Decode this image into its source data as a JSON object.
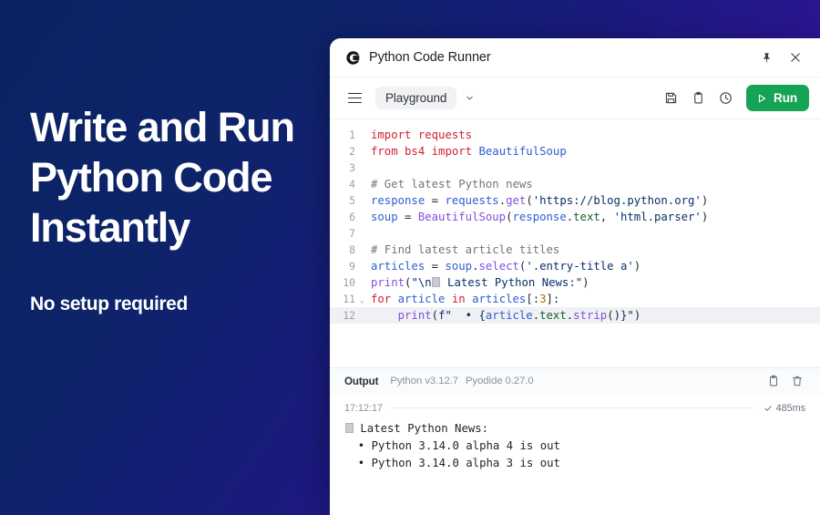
{
  "promo": {
    "title_lines": [
      "Write and Run",
      "Python Code",
      "Instantly"
    ],
    "subtitle": "No setup required",
    "colors": {
      "gradient_start": "#0a2364",
      "gradient_end": "#4512a6",
      "text": "#ffffff"
    }
  },
  "window": {
    "title": "Python Code Runner",
    "logo_icon": "brand-c-logo-icon",
    "pin_icon": "pushpin-icon",
    "close_icon": "close-icon"
  },
  "toolbar": {
    "menu_icon": "hamburger-menu-icon",
    "project_name": "Playground",
    "chevron_icon": "chevron-down-icon",
    "save_icon": "save-disk-icon",
    "copy_icon": "clipboard-icon",
    "history_icon": "clock-history-icon",
    "run_label": "Run",
    "run_icon": "play-triangle-icon",
    "run_color": "#15a355"
  },
  "editor": {
    "active_line": 12,
    "fold_marker_line": 11,
    "lines": [
      {
        "n": "1",
        "fold": "",
        "tokens": [
          {
            "t": "import",
            "c": "t-kw"
          },
          {
            "t": " requests",
            "c": "t-kw"
          }
        ]
      },
      {
        "n": "2",
        "fold": "",
        "tokens": [
          {
            "t": "from",
            "c": "t-kw"
          },
          {
            "t": " ",
            "c": "t-pun"
          },
          {
            "t": "bs4",
            "c": "t-kw"
          },
          {
            "t": " ",
            "c": "t-pun"
          },
          {
            "t": "import",
            "c": "t-kw"
          },
          {
            "t": " ",
            "c": "t-pun"
          },
          {
            "t": "BeautifulSoup",
            "c": "t-var"
          }
        ]
      },
      {
        "n": "3",
        "fold": "",
        "tokens": []
      },
      {
        "n": "4",
        "fold": "",
        "tokens": [
          {
            "t": "# Get latest Python news",
            "c": "t-com"
          }
        ]
      },
      {
        "n": "5",
        "fold": "",
        "tokens": [
          {
            "t": "response",
            "c": "t-var"
          },
          {
            "t": " = ",
            "c": "t-pun"
          },
          {
            "t": "requests",
            "c": "t-var"
          },
          {
            "t": ".",
            "c": "t-pun"
          },
          {
            "t": "get",
            "c": "t-fn"
          },
          {
            "t": "(",
            "c": "t-pun"
          },
          {
            "t": "'https://blog.python.org'",
            "c": "t-str"
          },
          {
            "t": ")",
            "c": "t-pun"
          }
        ]
      },
      {
        "n": "6",
        "fold": "",
        "tokens": [
          {
            "t": "soup",
            "c": "t-var"
          },
          {
            "t": " = ",
            "c": "t-pun"
          },
          {
            "t": "BeautifulSoup",
            "c": "t-cls"
          },
          {
            "t": "(",
            "c": "t-pun"
          },
          {
            "t": "response",
            "c": "t-var"
          },
          {
            "t": ".",
            "c": "t-pun"
          },
          {
            "t": "text",
            "c": "t-attr"
          },
          {
            "t": ", ",
            "c": "t-pun"
          },
          {
            "t": "'html.parser'",
            "c": "t-str"
          },
          {
            "t": ")",
            "c": "t-pun"
          }
        ]
      },
      {
        "n": "7",
        "fold": "",
        "tokens": []
      },
      {
        "n": "8",
        "fold": "",
        "tokens": [
          {
            "t": "# Find latest article titles",
            "c": "t-com"
          }
        ]
      },
      {
        "n": "9",
        "fold": "",
        "tokens": [
          {
            "t": "articles",
            "c": "t-var"
          },
          {
            "t": " = ",
            "c": "t-pun"
          },
          {
            "t": "soup",
            "c": "t-var"
          },
          {
            "t": ".",
            "c": "t-pun"
          },
          {
            "t": "select",
            "c": "t-fn"
          },
          {
            "t": "(",
            "c": "t-pun"
          },
          {
            "t": "'.entry-title a'",
            "c": "t-str"
          },
          {
            "t": ")",
            "c": "t-pun"
          }
        ]
      },
      {
        "n": "10",
        "fold": "",
        "tokens": [
          {
            "t": "print",
            "c": "t-fn"
          },
          {
            "t": "(",
            "c": "t-pun"
          },
          {
            "t": "\"\\n",
            "c": "t-str"
          },
          {
            "t": "__EMOJI__",
            "c": "t-str"
          },
          {
            "t": " Latest Python News:\"",
            "c": "t-str"
          },
          {
            "t": ")",
            "c": "t-pun"
          }
        ]
      },
      {
        "n": "11",
        "fold": "v",
        "tokens": [
          {
            "t": "for",
            "c": "t-kw"
          },
          {
            "t": " ",
            "c": "t-pun"
          },
          {
            "t": "article",
            "c": "t-var"
          },
          {
            "t": " ",
            "c": "t-pun"
          },
          {
            "t": "in",
            "c": "t-kw"
          },
          {
            "t": " ",
            "c": "t-pun"
          },
          {
            "t": "articles",
            "c": "t-var"
          },
          {
            "t": "[:",
            "c": "t-pun"
          },
          {
            "t": "3",
            "c": "t-num"
          },
          {
            "t": "]:",
            "c": "t-pun"
          }
        ]
      },
      {
        "n": "12",
        "fold": "",
        "tokens": [
          {
            "t": "    ",
            "c": "t-pun"
          },
          {
            "t": "print",
            "c": "t-fn"
          },
          {
            "t": "(",
            "c": "t-pun"
          },
          {
            "t": "f\"  • {",
            "c": "t-str"
          },
          {
            "t": "article",
            "c": "t-var"
          },
          {
            "t": ".",
            "c": "t-pun"
          },
          {
            "t": "text",
            "c": "t-attr"
          },
          {
            "t": ".",
            "c": "t-pun"
          },
          {
            "t": "strip",
            "c": "t-fn"
          },
          {
            "t": "()",
            "c": "t-pun"
          },
          {
            "t": "}\"",
            "c": "t-str"
          },
          {
            "t": ")",
            "c": "t-pun"
          }
        ]
      }
    ]
  },
  "output": {
    "label": "Output",
    "runtime": "Python v3.12.7",
    "engine": "Pyodide 0.27.0",
    "copy_icon": "clipboard-icon",
    "clear_icon": "trash-icon",
    "timestamp": "17:12:17",
    "duration": "485ms",
    "status_icon": "check-icon",
    "lines": [
      "__EMOJI__ Latest Python News:",
      "  • Python 3.14.0 alpha 4 is out",
      "  • Python 3.14.0 alpha 3 is out"
    ]
  }
}
